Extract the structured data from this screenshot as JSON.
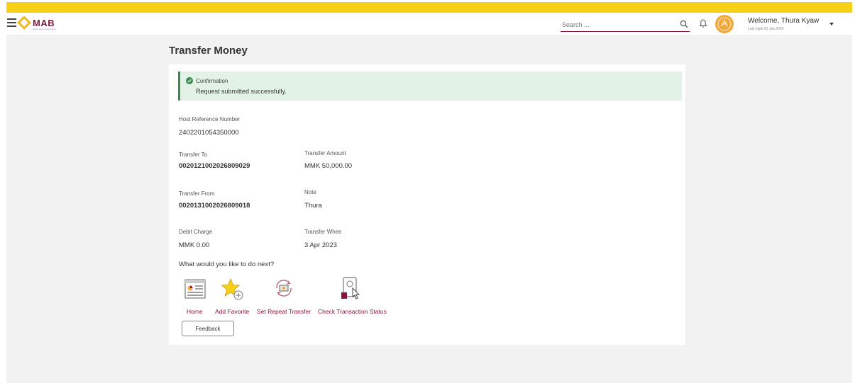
{
  "app": {
    "logo_text": "MAB",
    "logo_tagline": "better ways, better living"
  },
  "header": {
    "search_placeholder": "Search ...",
    "welcome": "Welcome, Thura Kyaw",
    "last_login": "Last login 22 Jan 2024,",
    "icons": [
      "menu-icon",
      "search-icon",
      "bell-icon",
      "avatar",
      "caret-down-icon"
    ]
  },
  "page": {
    "title": "Transfer Money"
  },
  "confirmation": {
    "title": "Confirmation",
    "message": "Request submitted successfully.",
    "color": "#e3f2e6",
    "accent": "#3b8a4a"
  },
  "details": {
    "host_ref_label": "Host Reference Number",
    "host_ref_value": "2402201054350000",
    "transfer_to_label": "Transfer To",
    "transfer_to_value": "0020121002026809029",
    "transfer_amount_label": "Transfer Amount",
    "transfer_amount_value": "MMK 50,000.00",
    "transfer_from_label": "Transfer From",
    "transfer_from_value": "0020131002026809018",
    "note_label": "Note",
    "note_value": "Thura",
    "debit_charge_label": "Debit Charge",
    "debit_charge_value": "MMK 0.00",
    "transfer_when_label": "Transfer When",
    "transfer_when_value": "3 Apr 2023"
  },
  "next": {
    "title": "What would you like to do next?",
    "actions": [
      {
        "label": "Home",
        "icon": "home-dashboard-icon"
      },
      {
        "label": "Add Favorite",
        "icon": "star-add-icon"
      },
      {
        "label": "Set Repeat Transfer",
        "icon": "repeat-transfer-icon"
      },
      {
        "label": "Check Transaction Status",
        "icon": "transaction-status-icon"
      }
    ],
    "feedback_label": "Feedback"
  },
  "colors": {
    "brand_yellow": "#f7d118",
    "brand_maroon": "#8a1538",
    "background": "#f2f2f2"
  }
}
